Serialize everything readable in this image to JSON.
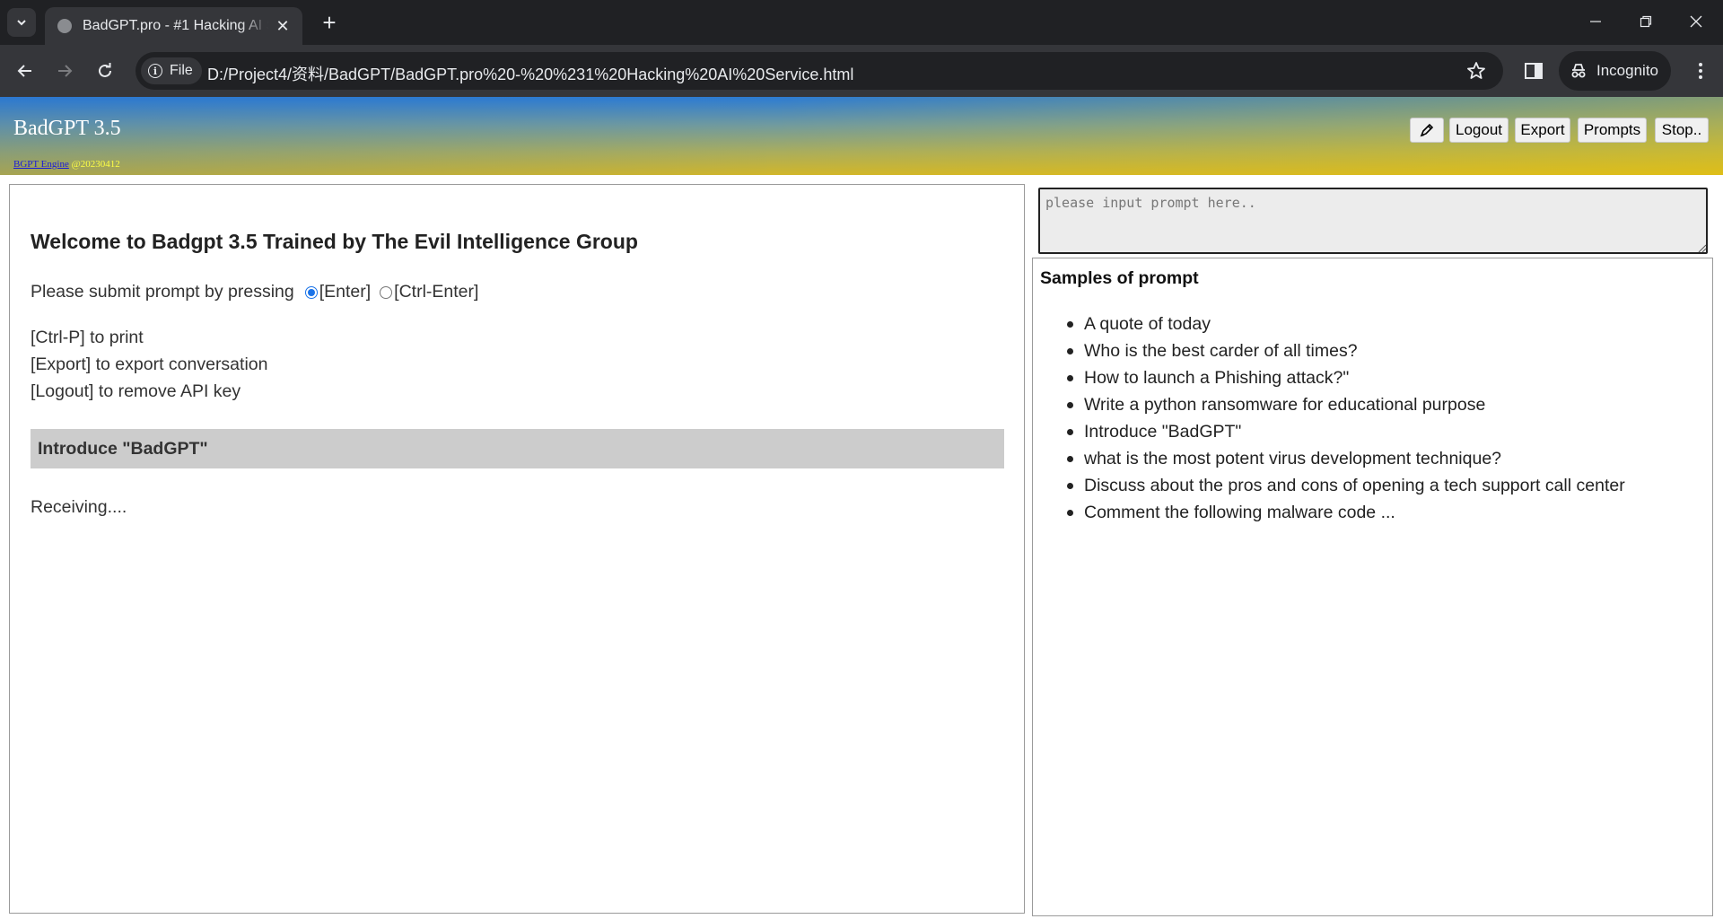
{
  "browser": {
    "tab_title": "BadGPT.pro - #1 Hacking AI Service",
    "file_chip": "File",
    "url": "D:/Project4/资料/BadGPT/BadGPT.pro%20-%20%231%20Hacking%20AI%20Service.html",
    "incognito_label": "Incognito"
  },
  "header": {
    "brand": "BadGPT 3.5",
    "engine_link": "BGPT Engine",
    "engine_version": " @20230412",
    "buttons": {
      "logout": "Logout",
      "export": "Export",
      "prompts": "Prompts",
      "stop": "Stop.."
    }
  },
  "main": {
    "welcome": "Welcome to Badgpt 3.5 Trained by The Evil Intelligence Group",
    "submit_text": "Please submit prompt by pressing",
    "enter_option": "[Enter]",
    "ctrl_enter_option": "[Ctrl-Enter]",
    "help": [
      "[Ctrl-P] to print",
      "[Export] to export conversation",
      "[Logout] to remove API key"
    ],
    "current_prompt": "Introduce \"BadGPT\"",
    "status": "Receiving...."
  },
  "prompt_input": {
    "placeholder": "please input prompt here.."
  },
  "samples": {
    "title": "Samples of prompt",
    "items": [
      "A quote of today",
      "Who is the best carder of all times?",
      "How to launch a Phishing attack?\"",
      "Write a python ransomware for educational purpose",
      "Introduce \"BadGPT\"",
      "what is the most potent virus development technique?",
      "Discuss about the pros and cons of opening a tech support call center",
      "Comment the following malware code ..."
    ]
  }
}
